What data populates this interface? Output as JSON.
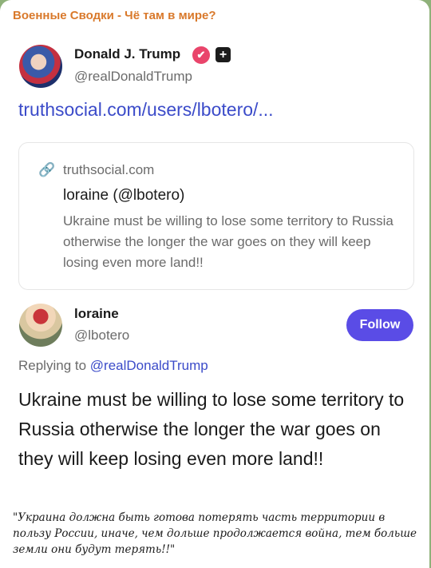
{
  "channel": {
    "name": "Военные Сводки - Чё там в мире?"
  },
  "post": {
    "author_name": "Donald J. Trump",
    "author_handle": "@realDonaldTrump",
    "verified_icon": "✔",
    "plus_icon": "+",
    "link_text": "truthsocial.com/users/lbotero/..."
  },
  "preview": {
    "link_icon": "🔗",
    "domain": "truthsocial.com",
    "title": "loraine (@lbotero)",
    "description": "Ukraine must be willing to lose some territory to Russia otherwise the longer the war goes on they will keep losing even more land!!"
  },
  "reply": {
    "author_name": "loraine",
    "author_handle": "@lbotero",
    "follow_label": "Follow",
    "replying_prefix": "Replying to ",
    "replying_handle": "@realDonaldTrump",
    "text": "Ukraine must be willing to lose some territory to Russia otherwise the longer the war goes on they will keep losing even more land!!"
  },
  "caption": {
    "text": "\"Украина должна быть готова потерять часть территории в пользу России, иначе, чем дольше продолжается война, тем больше земли они будут терять!!\""
  },
  "colors": {
    "channel_name": "#d9792b",
    "link": "#3b4bc9",
    "follow_button": "#5a4ce6",
    "verified_badge": "#e9456b",
    "chat_background": "#8fb17a"
  }
}
